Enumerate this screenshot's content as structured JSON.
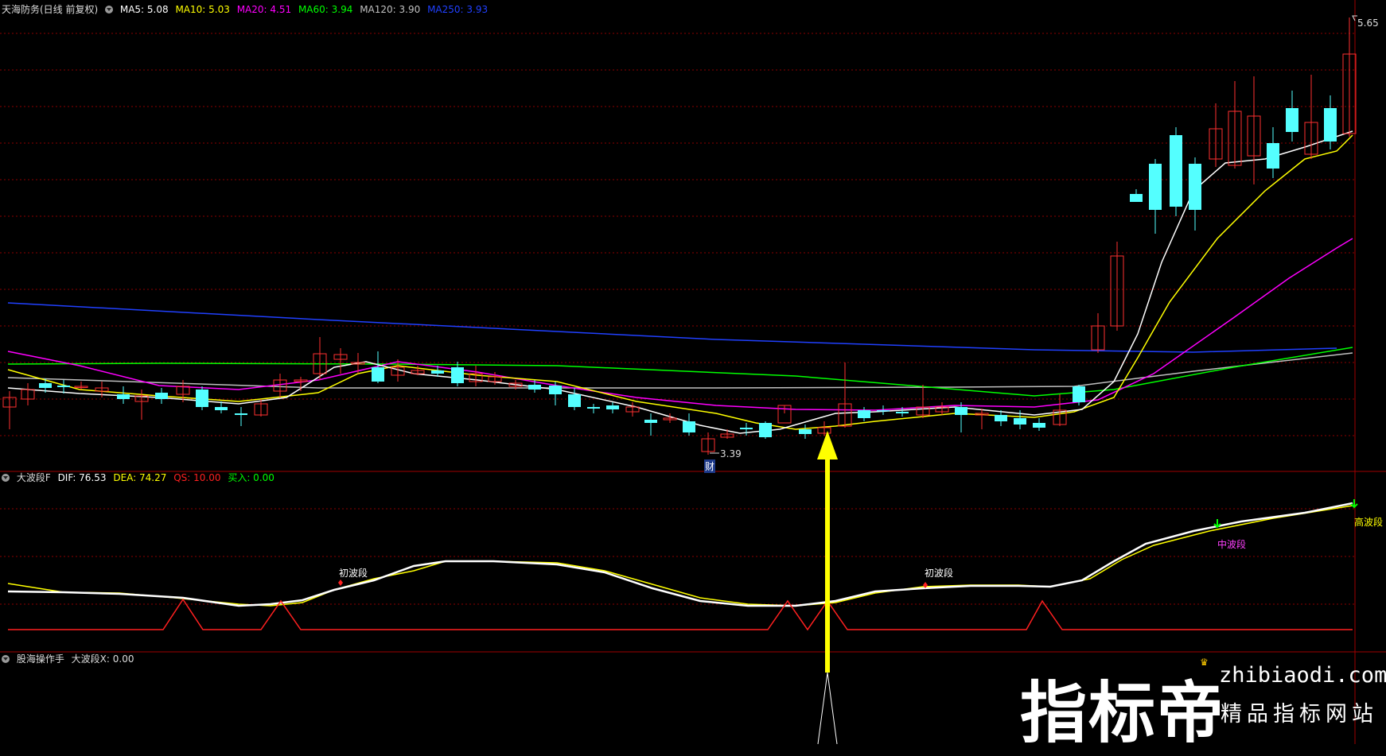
{
  "main_panel": {
    "title": "天海防务(日线 前复权)",
    "ma": [
      {
        "label": "MA5: 5.08",
        "color": "#ffffff"
      },
      {
        "label": "MA10: 5.03",
        "color": "#ffff00"
      },
      {
        "label": "MA20: 4.51",
        "color": "#ff00ff"
      },
      {
        "label": "MA60: 3.94",
        "color": "#00ff00"
      },
      {
        "label": "MA120: 3.90",
        "color": "#c0c0c0"
      },
      {
        "label": "MA250: 3.93",
        "color": "#2040ff"
      }
    ],
    "high_label": "5.65",
    "low_label": "3.39",
    "cai_label": "财"
  },
  "indicator_panel": {
    "name": "大波段F",
    "values": [
      {
        "label": "DIF: 76.53",
        "color": "#ffffff"
      },
      {
        "label": "DEA: 74.27",
        "color": "#ffff00"
      },
      {
        "label": "QS: 10.00",
        "color": "#ff2020"
      },
      {
        "label": "买入: 0.00",
        "color": "#00ff00"
      }
    ],
    "stage_labels": {
      "first_1": "初波段",
      "first_2": "初波段",
      "mid": "中波段",
      "high": "高波段"
    }
  },
  "bottom_panel": {
    "name": "股海操作手",
    "value": "大波段X: 0.00"
  },
  "watermark": {
    "brand": "指标帝",
    "domain": "zhibiaodi.com",
    "tagline": "精品指标网站"
  },
  "colors": {
    "up": "#ff3030",
    "down": "#54ffff",
    "grid": "#8b0000",
    "arrow": "#ffff00"
  }
}
